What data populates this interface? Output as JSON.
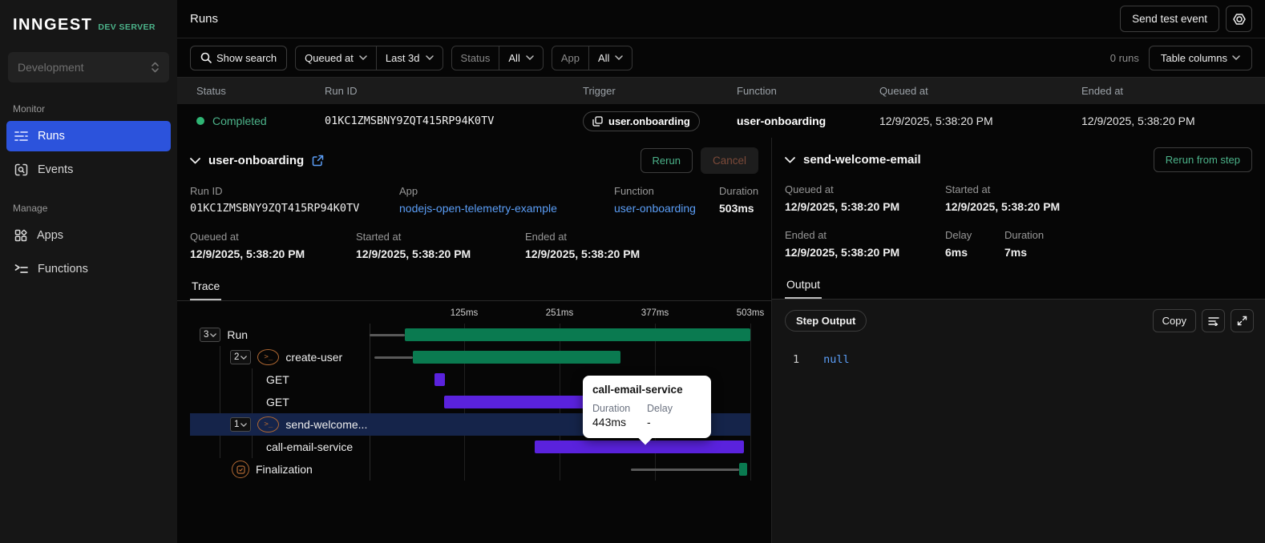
{
  "brand": {
    "logo": "INNGEST",
    "env": "DEV SERVER"
  },
  "sidebar": {
    "workspace": "Development",
    "monitor_label": "Monitor",
    "manage_label": "Manage",
    "runs": "Runs",
    "events": "Events",
    "apps": "Apps",
    "functions": "Functions"
  },
  "topbar": {
    "title": "Runs",
    "send_test_event": "Send test event"
  },
  "filters": {
    "show_search": "Show search",
    "field": "Queued at",
    "range": "Last 3d",
    "status_label": "Status",
    "status_value": "All",
    "app_label": "App",
    "app_value": "All",
    "count": "0 runs",
    "columns_button": "Table columns"
  },
  "table": {
    "columns": [
      "Status",
      "Run ID",
      "Trigger",
      "Function",
      "Queued at",
      "Ended at"
    ],
    "row": {
      "status": "Completed",
      "run_id": "01KC1ZMSBNY9ZQT415RP94K0TV",
      "trigger": "user.onboarding",
      "function": "user-onboarding",
      "queued_at": "12/9/2025, 5:38:20 PM",
      "ended_at": "12/9/2025, 5:38:20 PM"
    }
  },
  "run_panel": {
    "title": "user-onboarding",
    "rerun": "Rerun",
    "cancel": "Cancel",
    "run_id_label": "Run ID",
    "run_id": "01KC1ZMSBNY9ZQT415RP94K0TV",
    "app_label": "App",
    "app": "nodejs-open-telemetry-example",
    "function_label": "Function",
    "function": "user-onboarding",
    "duration_label": "Duration",
    "duration": "503ms",
    "queued_label": "Queued at",
    "queued": "12/9/2025, 5:38:20 PM",
    "started_label": "Started at",
    "started": "12/9/2025, 5:38:20 PM",
    "ended_label": "Ended at",
    "ended": "12/9/2025, 5:38:20 PM",
    "tab": "Trace"
  },
  "trace": {
    "total_ms": 503,
    "axis_ms": [
      125,
      251,
      377,
      503
    ],
    "axis_labels": [
      "125ms",
      "251ms",
      "377ms",
      "503ms"
    ],
    "rows": [
      {
        "name": "Run",
        "badge": "3",
        "icon": "none",
        "indent": "i0",
        "delay_ms": [
          0,
          47
        ],
        "bar_ms": [
          47,
          503
        ],
        "color": "green",
        "highlight": false
      },
      {
        "name": "create-user",
        "badge": "2",
        "icon": "terminal",
        "indent": "i1",
        "delay_ms": [
          6,
          57
        ],
        "bar_ms": [
          57,
          331
        ],
        "color": "green",
        "highlight": false
      },
      {
        "name": "GET",
        "badge": "",
        "icon": "none",
        "indent": "i2",
        "bar_ms": [
          86,
          100
        ],
        "color": "purple",
        "highlight": false
      },
      {
        "name": "GET",
        "badge": "",
        "icon": "none",
        "indent": "i2",
        "bar_ms": [
          98,
          287
        ],
        "color": "purple",
        "highlight": false
      },
      {
        "name": "send-welcome...",
        "badge": "1",
        "icon": "terminal",
        "indent": "i1",
        "bar_ms": [
          333,
          350
        ],
        "color": "green",
        "highlight": true
      },
      {
        "name": "call-email-service",
        "badge": "",
        "icon": "none",
        "indent": "i2",
        "bar_ms": [
          218,
          495
        ],
        "color": "purple",
        "highlight": false
      },
      {
        "name": "Finalization",
        "badge": "",
        "icon": "check",
        "indent": "i1n",
        "delay_ms": [
          345,
          488
        ],
        "bar_ms": [
          488,
          499
        ],
        "color": "green",
        "highlight": false
      }
    ],
    "tooltip": {
      "title": "call-email-service",
      "duration_label": "Duration",
      "duration": "443ms",
      "delay_label": "Delay",
      "delay": "-"
    }
  },
  "step_panel": {
    "title": "send-welcome-email",
    "rerun_from_step": "Rerun from step",
    "queued_label": "Queued at",
    "queued": "12/9/2025, 5:38:20 PM",
    "started_label": "Started at",
    "started": "12/9/2025, 5:38:20 PM",
    "ended_label": "Ended at",
    "ended": "12/9/2025, 5:38:20 PM",
    "delay_label": "Delay",
    "delay": "6ms",
    "duration_label": "Duration",
    "duration": "7ms",
    "tab": "Output",
    "output_badge": "Step Output",
    "copy": "Copy",
    "line_no": "1",
    "code": "null"
  },
  "colors": {
    "green_bar": "#0a7a50",
    "purple_bar": "#5a22dd",
    "accent_green": "#4cb38a",
    "link_blue": "#5b9ef7",
    "active_nav": "#2c53dc",
    "highlight_row": "#15244a",
    "orange_icon": "#b06832"
  }
}
